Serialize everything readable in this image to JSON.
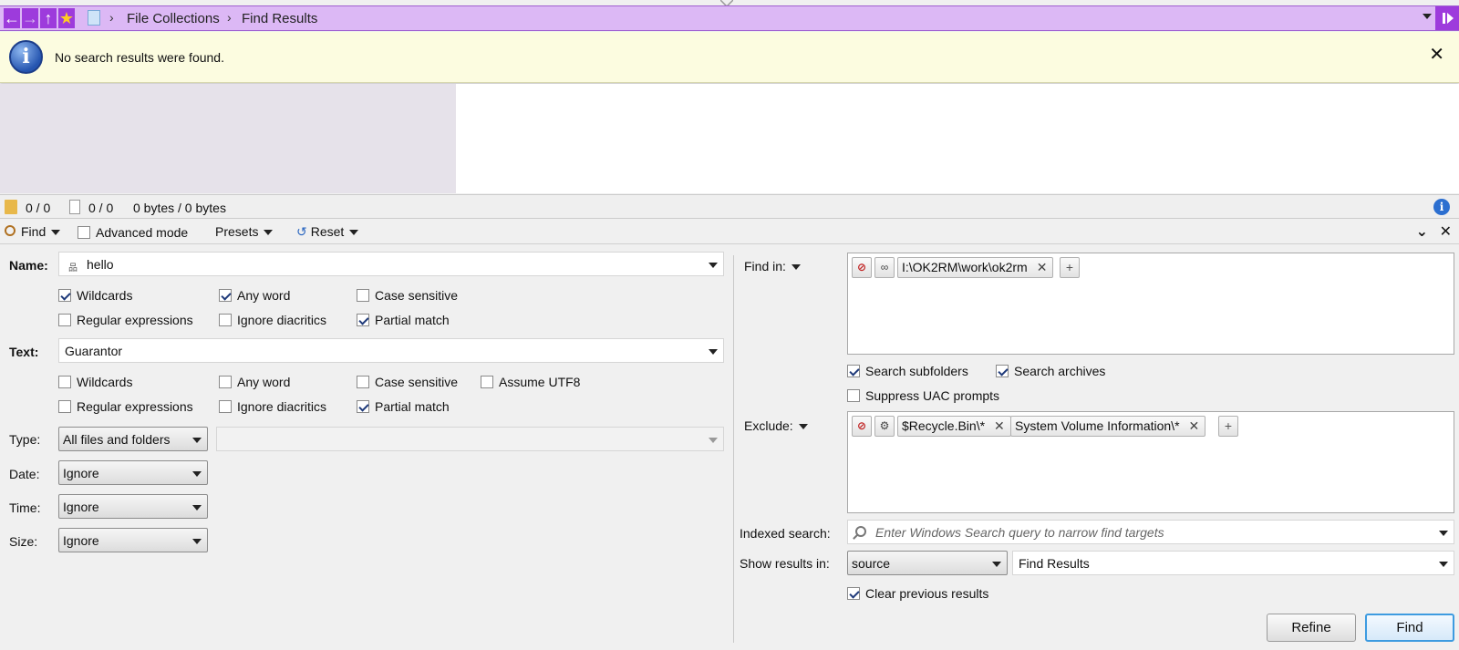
{
  "breadcrumb": {
    "items": [
      "File Collections",
      "Find Results"
    ]
  },
  "infobar": {
    "message": "No search results were found."
  },
  "status": {
    "folders": "0 / 0",
    "files": "0 / 0",
    "size": "0 bytes / 0 bytes"
  },
  "toolbar": {
    "find": "Find",
    "advanced": "Advanced mode",
    "presets": "Presets",
    "reset": "Reset"
  },
  "name": {
    "label": "Name:",
    "value": "hello",
    "options": {
      "wildcards": {
        "label": "Wildcards",
        "checked": true
      },
      "any_word": {
        "label": "Any word",
        "checked": true
      },
      "case_sensitive": {
        "label": "Case sensitive",
        "checked": false
      },
      "regex": {
        "label": "Regular expressions",
        "checked": false
      },
      "ignore_diacritics": {
        "label": "Ignore diacritics",
        "checked": false
      },
      "partial_match": {
        "label": "Partial match",
        "checked": true
      }
    }
  },
  "text": {
    "label": "Text:",
    "value": "Guarantor",
    "options": {
      "wildcards": {
        "label": "Wildcards",
        "checked": false
      },
      "any_word": {
        "label": "Any word",
        "checked": false
      },
      "case_sensitive": {
        "label": "Case sensitive",
        "checked": false
      },
      "assume_utf8": {
        "label": "Assume UTF8",
        "checked": false
      },
      "regex": {
        "label": "Regular expressions",
        "checked": false
      },
      "ignore_diacritics": {
        "label": "Ignore diacritics",
        "checked": false
      },
      "partial_match": {
        "label": "Partial match",
        "checked": true
      }
    }
  },
  "type": {
    "label": "Type:",
    "value": "All files and folders",
    "secondary": ""
  },
  "date": {
    "label": "Date:",
    "value": "Ignore"
  },
  "time": {
    "label": "Time:",
    "value": "Ignore"
  },
  "size": {
    "label": "Size:",
    "value": "Ignore"
  },
  "find_in": {
    "label": "Find in:",
    "paths": [
      "I:\\OK2RM\\work\\ok2rm"
    ],
    "search_subfolders": {
      "label": "Search subfolders",
      "checked": true
    },
    "search_archives": {
      "label": "Search archives",
      "checked": true
    },
    "suppress_uac": {
      "label": "Suppress UAC prompts",
      "checked": false
    }
  },
  "exclude": {
    "label": "Exclude:",
    "paths": [
      "$Recycle.Bin\\*",
      "System Volume Information\\*"
    ]
  },
  "indexed": {
    "label": "Indexed search:",
    "placeholder": "Enter Windows Search query to narrow find targets"
  },
  "show_results": {
    "label": "Show results in:",
    "source": "source",
    "target": "Find Results",
    "clear_previous": {
      "label": "Clear previous results",
      "checked": true
    }
  },
  "buttons": {
    "refine": "Refine",
    "find": "Find"
  },
  "colors": {
    "accent": "#9d3bdc",
    "breadcrumb_bg": "#dcb8f5",
    "infobar_bg": "#fcfce0",
    "primary_button_border": "#3d9be0"
  }
}
